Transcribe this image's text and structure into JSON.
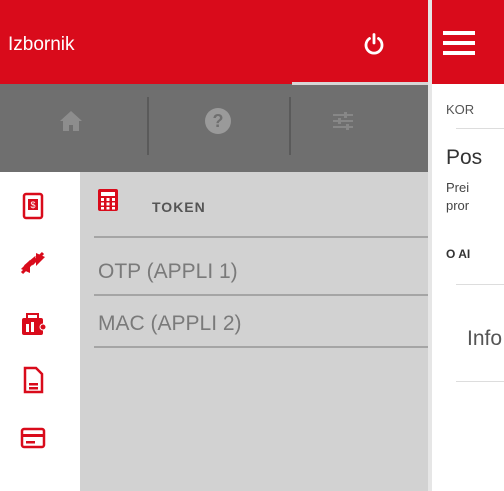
{
  "drawer": {
    "title": "Izbornik",
    "list": {
      "header": "TOKEN",
      "items": [
        "OTP (APPLI 1)",
        "MAC (APPLI 2)"
      ]
    }
  },
  "main": {
    "section1": "KOR",
    "heading": "Pos",
    "text_line1": "Prei",
    "text_line2": "pror",
    "section2": "O AI",
    "info": "Info"
  },
  "colors": {
    "brand_red": "#d90b1b",
    "iconbar_gray": "#6f6f6f",
    "drawer_gray": "#d2d2d2"
  },
  "icons": {
    "header": "power-icon",
    "iconbar": [
      "home-icon",
      "help-icon",
      "settings-sliders-icon"
    ],
    "rail": [
      "mobile-wallet-icon",
      "transfer-arrows-icon",
      "city-wallet-icon",
      "document-icon",
      "card-icon"
    ],
    "token": "calculator-icon",
    "menu": "hamburger-icon"
  }
}
